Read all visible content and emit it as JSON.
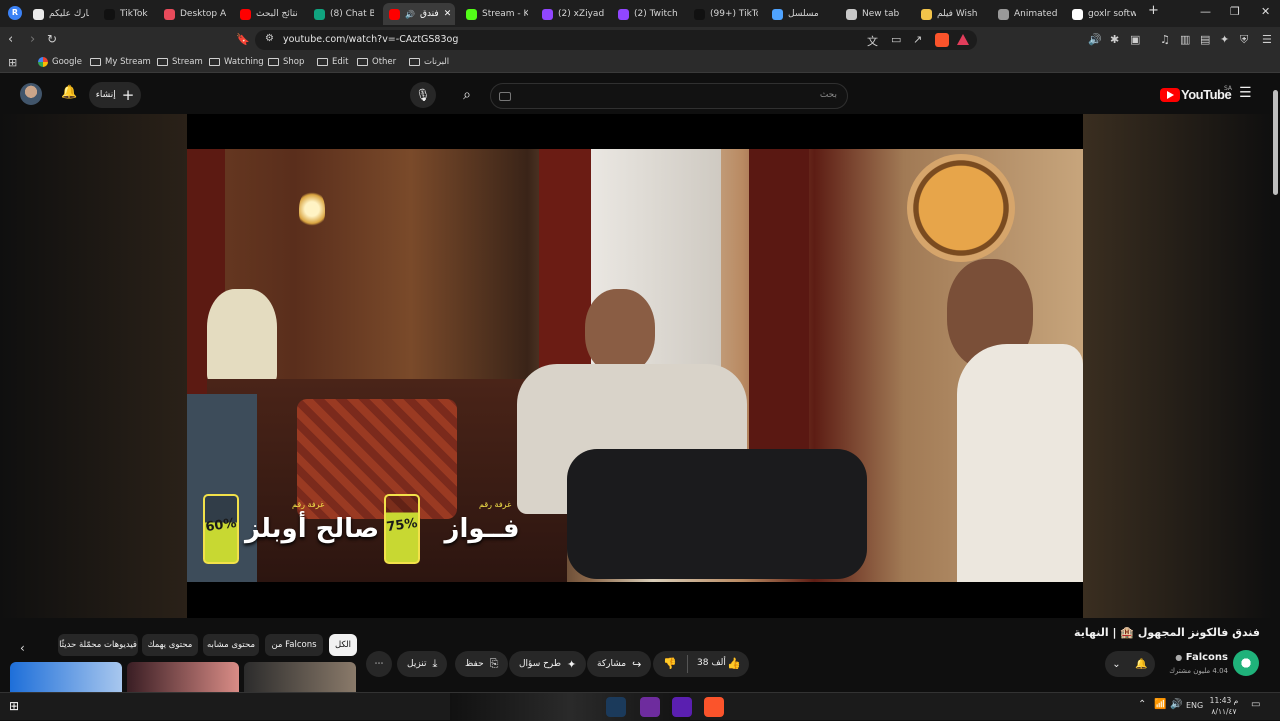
{
  "browser": {
    "profile_initial": "R",
    "tabs": [
      {
        "title": "مبارك عليكم",
        "color": "#e9e9e9"
      },
      {
        "title": "TikTok",
        "color": "#111111"
      },
      {
        "title": "Desktop Ap",
        "color": "#e84b5b"
      },
      {
        "title": "نتائج البحث",
        "color": "#ff0000"
      },
      {
        "title": "(8) Chat Bo",
        "color": "#10a37f"
      },
      {
        "title": "فندق",
        "color": "#ff0000",
        "active": true
      },
      {
        "title": "Stream - Ki",
        "color": "#53fc18"
      },
      {
        "title": "(2) xZiyad",
        "color": "#9146ff"
      },
      {
        "title": "(2) Twitch",
        "color": "#9146ff"
      },
      {
        "title": "(99+) TikTok",
        "color": "#111111"
      },
      {
        "title": "مسلسل",
        "color": "#4fa3ff"
      },
      {
        "title": "New tab",
        "color": "#c9c9c9"
      },
      {
        "title": "فيلم Wish",
        "color": "#f3c44a"
      },
      {
        "title": "Animated G",
        "color": "#999999"
      },
      {
        "title": "goxlr softw",
        "color": "#ffffff"
      }
    ],
    "url": "youtube.com/watch?v=-CAztGS83og",
    "bookmarks": [
      "Google",
      "My Stream",
      "Stream",
      "Watching",
      "Shop",
      "Edit",
      "Other",
      "البرنات"
    ]
  },
  "youtube": {
    "logo_text": "YouTube",
    "region": "SA",
    "create_label": "إنشاء",
    "search_placeholder": "بحث",
    "video_title": "فندق فالكونز المجهول 🏨 | النهاية",
    "channel_name": "Falcons",
    "subscribers": "4.04 مليون مشترك",
    "likes": "38 ألف",
    "actions": {
      "share": "مشاركة",
      "ask": "طرح سؤال",
      "save": "حفظ",
      "download": "تنزيل"
    },
    "chips": [
      "الكل",
      "من Falcons",
      "محتوى مشابه",
      "محتوى يهمك",
      "فيديوهات محمّلة حديثًا"
    ],
    "overlay": {
      "guest1": {
        "name": "صالح أوبلز",
        "caption": "غرفة رقم",
        "battery": "60%"
      },
      "guest2": {
        "name": "فــواز",
        "caption": "غرفة رقم",
        "battery": "75%"
      }
    }
  },
  "taskbar": {
    "language": "ENG",
    "time": "11:43 م",
    "date": "٨/١١/٤٧",
    "apps": [
      {
        "name": "steam",
        "color": "#1b3a5b"
      },
      {
        "name": "goxlr",
        "color": "#6e2c9e"
      },
      {
        "name": "next",
        "color": "#5a1fb0"
      },
      {
        "name": "brave",
        "color": "#fb542b"
      }
    ]
  }
}
